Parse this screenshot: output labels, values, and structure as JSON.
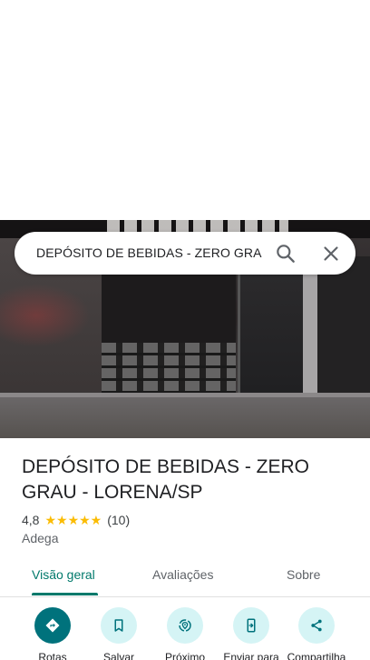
{
  "search": {
    "query": "DEPÓSITO DE BEBIDAS - ZERO GRA"
  },
  "place": {
    "title": "DEPÓSITO DE BEBIDAS - ZERO GRAU - LORENA/SP",
    "rating": "4,8",
    "stars": "★★★★★",
    "review_count": "(10)",
    "category": "Adega"
  },
  "tabs": [
    {
      "label": "Visão geral",
      "active": true
    },
    {
      "label": "Avaliações",
      "active": false
    },
    {
      "label": "Sobre",
      "active": false
    }
  ],
  "actions": [
    {
      "label": "Rotas",
      "icon": "directions-icon"
    },
    {
      "label": "Salvar",
      "icon": "bookmark-icon"
    },
    {
      "label": "Próximo",
      "icon": "nearby-icon"
    },
    {
      "label": "Enviar para",
      "icon": "send-to-phone-icon"
    },
    {
      "label": "Compartilha",
      "icon": "share-icon"
    }
  ],
  "colors": {
    "accent": "#00796b",
    "action_bg": "#d5f4f5",
    "primary_action_bg": "#00727c",
    "star": "#fbbc04"
  }
}
